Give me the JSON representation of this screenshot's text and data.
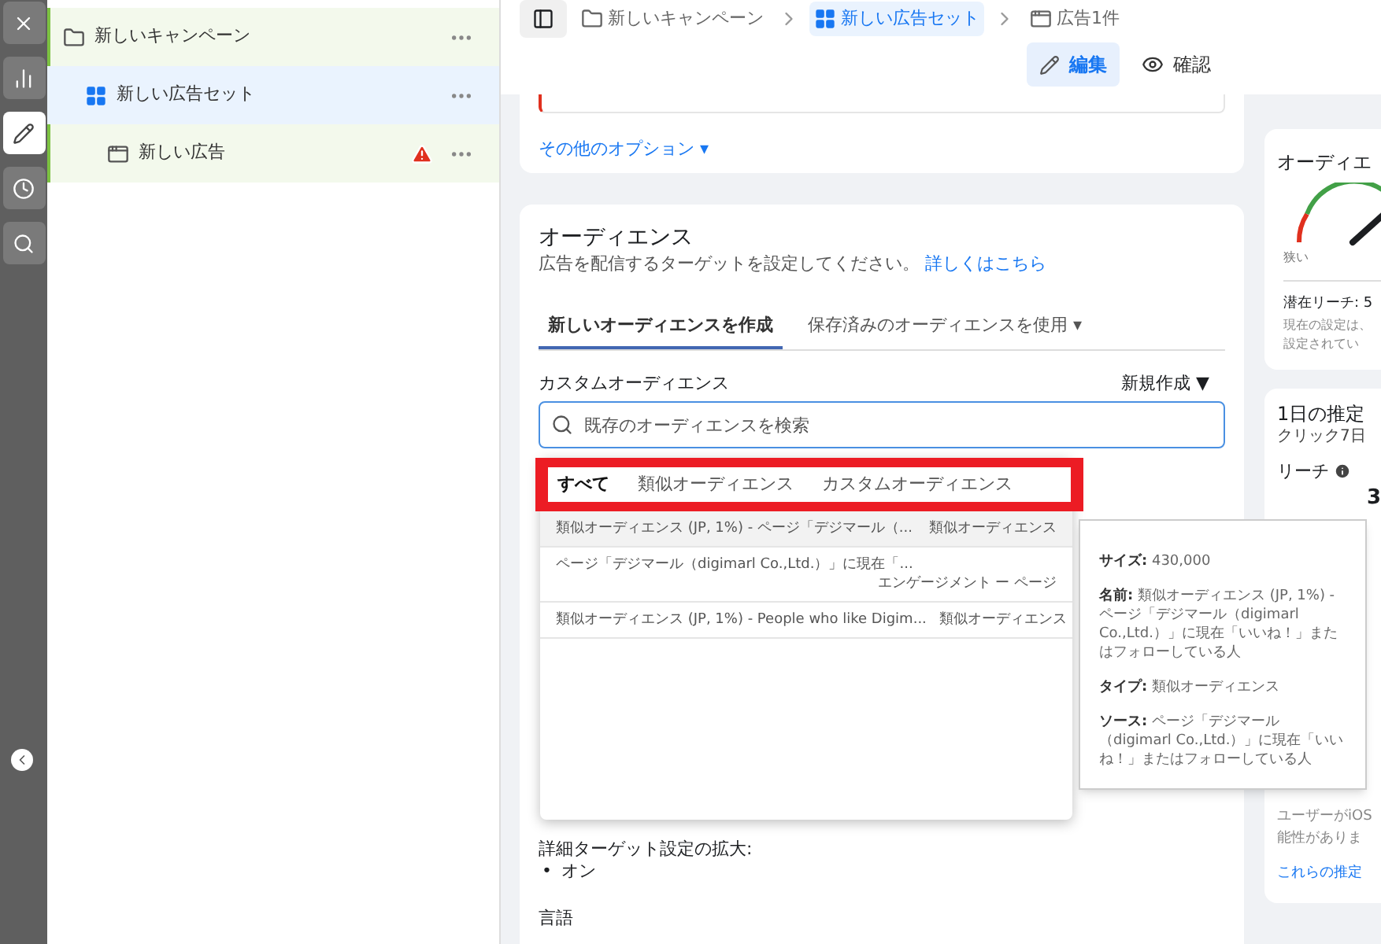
{
  "rail": [
    {
      "kind": "close",
      "selected": false
    },
    {
      "kind": "chart",
      "selected": false
    },
    {
      "kind": "edit",
      "selected": true
    },
    {
      "kind": "clock",
      "selected": false
    },
    {
      "kind": "search",
      "selected": false
    }
  ],
  "tree": [
    {
      "label": "新しいキャンペーン",
      "kind": "campaign",
      "selected": false,
      "warning": false,
      "children": [
        {
          "label": "新しい広告セット",
          "kind": "adset",
          "selected": true,
          "warning": false,
          "children": [
            {
              "label": "新しい広告",
              "kind": "ad",
              "selected": false,
              "warning": true
            }
          ]
        }
      ]
    }
  ],
  "breadcrumb": [
    {
      "label": "新しいキャンペーン",
      "kind": "campaign",
      "selected": false
    },
    {
      "label": "新しい広告セット",
      "kind": "adset",
      "selected": true
    },
    {
      "label": "広告1件",
      "kind": "ad",
      "selected": false
    }
  ],
  "modes": [
    {
      "label": "編集",
      "kind": "edit",
      "selected": true
    },
    {
      "label": "確認",
      "kind": "view",
      "selected": false
    }
  ],
  "more_options": {
    "label": "その他のオプション",
    "caret": "▾"
  },
  "audience": {
    "title": "オーディエンス",
    "description": "広告を配信するターゲットを設定してください。",
    "learn_more": "詳しくはこちら",
    "tabs": [
      {
        "label": "新しいオーディエンスを作成",
        "selected": true
      },
      {
        "label": "保存済みのオーディエンスを使用",
        "selected": false,
        "caret": "▾"
      }
    ],
    "custom_label": "カスタムオーディエンス",
    "create_new": {
      "label": "新規作成",
      "caret": "▼"
    },
    "search": {
      "placeholder": "既存のオーディエンスを検索"
    },
    "filters": {
      "highlighted": true,
      "items": [
        {
          "label": "すべて",
          "selected": true
        },
        {
          "label": "類似オーディエンス",
          "selected": false
        },
        {
          "label": "カスタムオーディエンス",
          "selected": false
        }
      ]
    },
    "results": [
      {
        "name": "類似オーディエンス (JP, 1%) - ページ「デジマール（...",
        "type": "類似オーディエンス",
        "kind": "inline",
        "selected": true
      },
      {
        "name": "ページ「デジマール（digimarl Co.,Ltd.）」に現在「...",
        "type": "エンゲージメント ー ページ",
        "kind": "wrapped",
        "selected": false
      },
      {
        "name": "類似オーディエンス (JP, 1%) - People who like Digim...",
        "type": "類似オーディエンス",
        "kind": "inline",
        "selected": false
      }
    ],
    "expansion_label": "詳細ターゲット設定の拡大:",
    "expansion_bullet": "•",
    "expansion_value": "オン",
    "language_label": "言語"
  },
  "tooltip": [
    {
      "label": "サイズ:",
      "value": "430,000"
    },
    {
      "label": "名前:",
      "value": "類似オーディエンス (JP, 1%) - ページ「デジマール（digimarl Co.,Ltd.）」に現在「いいね！」またはフォローしている人"
    },
    {
      "label": "タイプ:",
      "value": "類似オーディエンス"
    },
    {
      "label": "ソース:",
      "value": "ページ「デジマール（digimarl Co.,Ltd.）」に現在「いいね！」またはフォローしている人"
    }
  ],
  "size_card": {
    "title": "オーディエ",
    "narrow_label": "狭い",
    "reach": "潜在リーチ: 5",
    "notes": [
      "現在の設定は、",
      "設定されてい"
    ]
  },
  "estimate_card": {
    "title": "1日の推定",
    "subtitle": "クリック7日",
    "reach_label": "リーチ",
    "reach_value": "3",
    "notes": [
      "ユーザーがiOS",
      "能性がありま"
    ],
    "link": "これらの推定"
  }
}
